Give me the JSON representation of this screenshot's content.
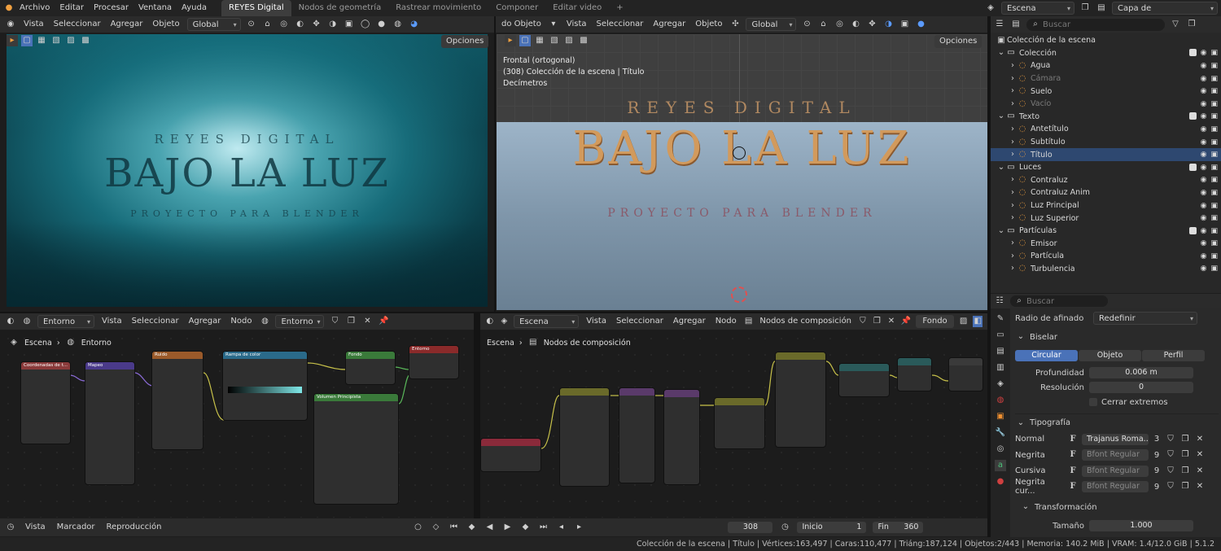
{
  "topbar": {
    "menus": [
      "Archivo",
      "Editar",
      "Procesar",
      "Ventana",
      "Ayuda"
    ],
    "workspaces": [
      "REYES Digital",
      "Nodos de geometría",
      "Rastrear movimiento",
      "Componer",
      "Editar video"
    ],
    "active_workspace": "REYES Digital",
    "add_tab": "+",
    "scene": "Escena",
    "view_layer": "Capa de visualización"
  },
  "viewport_left": {
    "menus": [
      "Vista",
      "Seleccionar",
      "Agregar",
      "Objeto"
    ],
    "orientation": "Global",
    "options": "Opciones",
    "scene_top": "REYES DIGITAL",
    "scene_main": "BAJO LA LUZ",
    "scene_sub": "PROYECTO PARA BLENDER"
  },
  "viewport_right": {
    "mode": "do Objeto",
    "menus": [
      "Vista",
      "Seleccionar",
      "Agregar",
      "Objeto"
    ],
    "orientation": "Global",
    "options": "Opciones",
    "overlay_line1": "Frontal (ortogonal)",
    "overlay_line2": "(308) Colección de la escena | Título",
    "overlay_line3": "Decímetros",
    "scene_top": "REYES DIGITAL",
    "scene_main": "BAJO LA LUZ",
    "scene_sub": "PROYECTO PARA BLENDER"
  },
  "outliner": {
    "search_placeholder": "Buscar",
    "root": "Colección de la escena",
    "rows": [
      {
        "label": "Colección",
        "indent": 1,
        "type": "collection"
      },
      {
        "label": "Agua",
        "indent": 2,
        "type": "object"
      },
      {
        "label": "Cámara",
        "indent": 2,
        "type": "object",
        "dim": true
      },
      {
        "label": "Suelo",
        "indent": 2,
        "type": "object"
      },
      {
        "label": "Vacío",
        "indent": 2,
        "type": "object",
        "dim": true
      },
      {
        "label": "Texto",
        "indent": 1,
        "type": "collection"
      },
      {
        "label": "Antetítulo",
        "indent": 2,
        "type": "object"
      },
      {
        "label": "Subtítulo",
        "indent": 2,
        "type": "object"
      },
      {
        "label": "Título",
        "indent": 2,
        "type": "object",
        "selected": true
      },
      {
        "label": "Luces",
        "indent": 1,
        "type": "collection"
      },
      {
        "label": "Contraluz",
        "indent": 2,
        "type": "object"
      },
      {
        "label": "Contraluz Anim",
        "indent": 2,
        "type": "object"
      },
      {
        "label": "Luz Principal",
        "indent": 2,
        "type": "object"
      },
      {
        "label": "Luz Superior",
        "indent": 2,
        "type": "object"
      },
      {
        "label": "Partículas",
        "indent": 1,
        "type": "collection"
      },
      {
        "label": "Emisor",
        "indent": 2,
        "type": "object"
      },
      {
        "label": "Partícula",
        "indent": 2,
        "type": "object"
      },
      {
        "label": "Turbulencia",
        "indent": 2,
        "type": "object"
      }
    ]
  },
  "properties": {
    "search_placeholder": "Buscar",
    "radio_afinado_label": "Radio de afinado",
    "radio_afinado_value": "Redefinir",
    "biselar": "Biselar",
    "bevel_modes": [
      "Circular",
      "Objeto",
      "Perfil"
    ],
    "bevel_active": "Circular",
    "profundidad_label": "Profundidad",
    "profundidad_value": "0.006 m",
    "resolucion_label": "Resolución",
    "resolucion_value": "0",
    "cerrar_extremos": "Cerrar extremos",
    "tipografia": "Tipografía",
    "fonts": [
      {
        "label": "Normal",
        "font": "Trajanus Roma...",
        "users": "3"
      },
      {
        "label": "Negrita",
        "font": "Bfont Regular",
        "users": "9"
      },
      {
        "label": "Cursiva",
        "font": "Bfont Regular",
        "users": "9"
      },
      {
        "label": "Negrita cur...",
        "font": "Bfont Regular",
        "users": "9"
      }
    ],
    "transformacion": "Transformación",
    "tamano_label": "Tamaño",
    "tamano_value": "1.000"
  },
  "shader_editor": {
    "type": "Entorno",
    "menus": [
      "Vista",
      "Seleccionar",
      "Agregar",
      "Nodo"
    ],
    "world": "Entorno",
    "breadcrumb_scene": "Escena",
    "breadcrumb_world": "Entorno",
    "nodes": {
      "coords": "Coordenadas de t...",
      "mapping": "Mapeo",
      "noise": "Ruido",
      "ramp": "Rampa de color",
      "background": "Fondo",
      "output": "Entorno",
      "volume": "Volumen Principista"
    }
  },
  "compositor": {
    "scene": "Escena",
    "menus": [
      "Vista",
      "Seleccionar",
      "Agregar",
      "Nodo"
    ],
    "tree": "Nodos de composición",
    "backdrop": "Fondo",
    "breadcrumb_scene": "Escena",
    "breadcrumb_tree": "Nodos de composición"
  },
  "timeline": {
    "menus": [
      "Vista",
      "Marcador",
      "Reproducción"
    ],
    "frame": "308",
    "start_label": "Inicio",
    "start_value": "1",
    "end_label": "Fin",
    "end_value": "360"
  },
  "statusbar": {
    "text": "Colección de la escena | Título | Vértices:163,497 | Caras:110,477 | Triáng:187,124 | Objetos:2/443 | Memoria: 140.2 MiB | VRAM: 1.4/12.0 GiB | 5.1.2"
  }
}
